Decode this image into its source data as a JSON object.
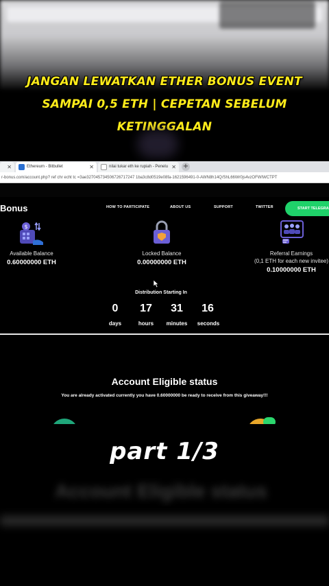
{
  "overlay": {
    "line1": "JANGAN LEWATKAN ETHER BONUS EVENT",
    "line2": "SAMPAI 0,5 ETH | CEPETAN SEBELUM",
    "line3": "KETINGGALAN",
    "part": "part   1/3"
  },
  "browser": {
    "tabs": [
      {
        "label": ""
      },
      {
        "label": "Ethereum - Bitbullet"
      },
      {
        "label": "nilai tukar eth ke rupiah - Penelu"
      }
    ],
    "new_tab": "+",
    "url": "r-bonus.com/account.php?  ref  chr  echt  tc   =3ae327045734506726717247 1ba3c8d0519e08fa-1621596491-0-AWN8h14Q/ShL66Wr0js4vzOFWIWCTPT"
  },
  "site": {
    "brand": "Bonus",
    "nav": [
      "HOW TO PARTICIPATE",
      "ABOUT US",
      "SUPPORT",
      "TWITTER"
    ],
    "cta": "START TELEGRAM",
    "available": {
      "label": "Available Balance",
      "value": "0.60000000 ETH"
    },
    "locked": {
      "label": "Locked Balance",
      "value": "0.00000000 ETH"
    },
    "referral": {
      "label": "Referral Earnings",
      "sub": "(0,1 ETH for each new invitee)",
      "value": "0.10000000 ETH"
    },
    "distribution": "Distribution Starting In",
    "countdown": {
      "days": "0",
      "hours": "17",
      "minutes": "31",
      "seconds": "16",
      "days_label": "days",
      "hours_label": "hours",
      "minutes_label": "minutes",
      "seconds_label": "seconds"
    },
    "eligible_title": "Account Eligible status",
    "eligible_text": "You are already activated currently you have 0.60000000 be ready to receive from this giveaway!!!"
  },
  "blurred": {
    "title": "Account Eligible status"
  },
  "colors": {
    "accent_yellow": "#ffec1a",
    "cta_green": "#1fd26a",
    "icon_purple": "#6b5fd6"
  }
}
